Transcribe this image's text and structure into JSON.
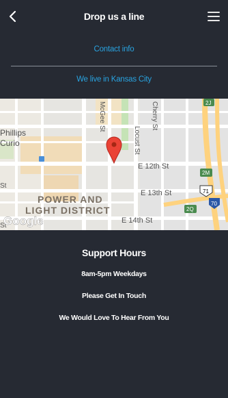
{
  "header": {
    "title": "Drop us a line",
    "back_icon": "chevron-left-icon",
    "menu_icon": "hamburger-menu-icon"
  },
  "contact_link": "Contact info",
  "location_link": "We live in Kansas City",
  "map": {
    "district_line1": "POWER AND",
    "district_line2": "LIGHT DISTRICT",
    "place_line1": "Phillips",
    "place_line2": "Curio",
    "street_mcgee": "McGee St",
    "street_locust": "Locust St",
    "street_cherry": "Cherry St",
    "street_12th": "E 12th St",
    "street_13th": "E 13th St",
    "street_14th": "E 14th St",
    "street_st_left1": "St",
    "street_st_left2": "St",
    "shield_71": "71",
    "shield_70": "70",
    "shield_2j": "2J",
    "shield_2m": "2M",
    "shield_2q": "2Q",
    "brand": "Google",
    "marker_icon": "map-pin-icon",
    "colors": {
      "road": "#ffffff",
      "park": "#c5e3b6",
      "highway": "#fed27e",
      "marker": "#ea4335"
    }
  },
  "support": {
    "title": "Support Hours",
    "line1": "8am-5pm Weekdays",
    "line2": "Please Get In Touch",
    "line3": "We Would Love To Hear From You"
  },
  "colors": {
    "background": "#262a33",
    "link": "#29a3e0",
    "divider": "#8a8f99"
  }
}
